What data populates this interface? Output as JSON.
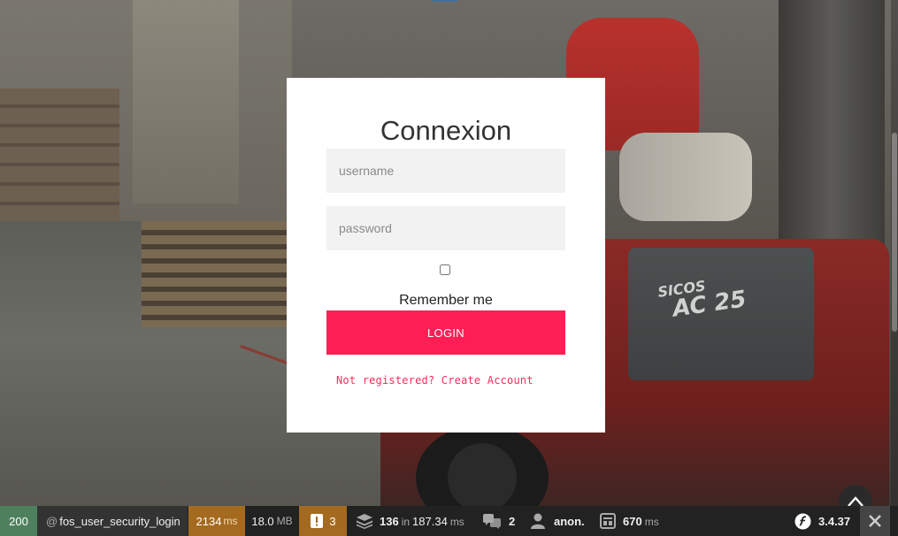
{
  "login": {
    "title": "Connexion",
    "username_placeholder": "username",
    "password_placeholder": "password",
    "remember_label": "Remember me",
    "login_label": "LOGIN",
    "register_link": "Not registered? Create Account"
  },
  "background": {
    "forklift_text_line1": "SICOS",
    "forklift_text_line2": "AC 25"
  },
  "toolbar": {
    "status_code": "200",
    "route_prefix": "@",
    "route": "fos_user_security_login",
    "time_value": "2134",
    "time_unit": "ms",
    "memory_value": "18.0",
    "memory_unit": "MB",
    "warnings": "3",
    "queries": "136",
    "queries_in": "in",
    "queries_time": "187.34",
    "queries_unit": "ms",
    "translations": "2",
    "user": "anon.",
    "cache_value": "670",
    "cache_unit": "ms",
    "symfony_version": "3.4.37"
  },
  "colors": {
    "accent": "#ff1f55",
    "status_ok": "#4f805d",
    "toolbar_warn": "#a46a1f",
    "toolbar_bg": "#222222"
  },
  "icons": [
    "warning-icon",
    "layers-icon",
    "translation-icon",
    "user-icon",
    "cache-icon",
    "symfony-logo-icon",
    "close-icon",
    "arrow-up-icon"
  ]
}
